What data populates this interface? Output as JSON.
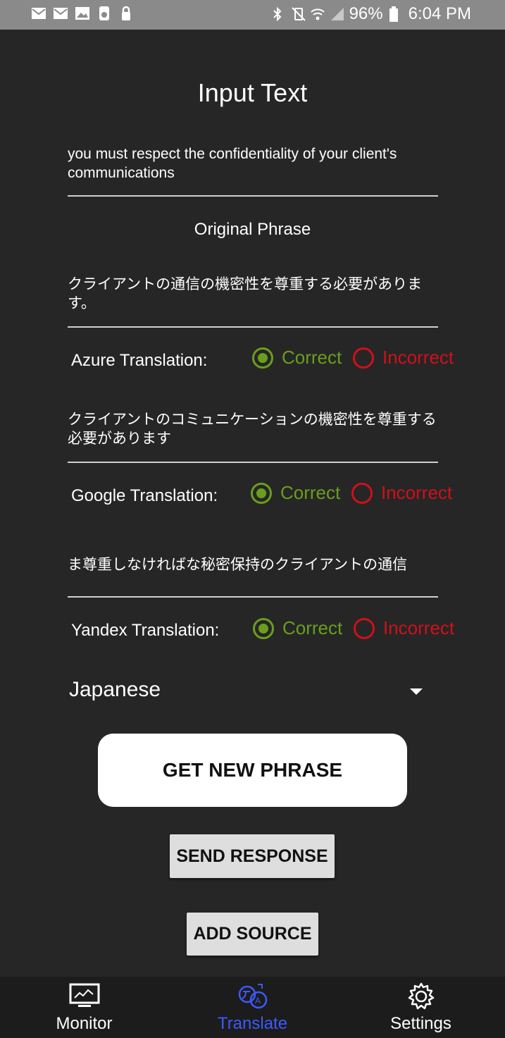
{
  "status_bar": {
    "battery": "96%",
    "time": "6:04 PM",
    "left_icons": [
      "mail-icon",
      "mail-icon",
      "image-icon",
      "lock-icon",
      "lock-icon"
    ],
    "right_icons": [
      "bluetooth-icon",
      "vibrate-mute-icon",
      "wifi-icon",
      "signal-icon",
      "battery-icon"
    ]
  },
  "page": {
    "title": "Input Text"
  },
  "input_text": {
    "value": "you must respect the confidentiality of your client's communications"
  },
  "original": {
    "label": "Original Phrase",
    "value": "クライアントの通信の機密性を尊重する必要があります。"
  },
  "azure": {
    "label": "Azure Translation:",
    "value": "クライアントのコミュニケーションの機密性を尊重する必要があります"
  },
  "google": {
    "label": "Google Translation:",
    "value": "ま尊重しなければな秘密保持のクライアントの通信"
  },
  "yandex": {
    "label": "Yandex Translation:"
  },
  "radio": {
    "correct": "Correct",
    "incorrect": "Incorrect"
  },
  "language": {
    "selected": "Japanese"
  },
  "buttons": {
    "get_new_phrase": "GET NEW PHRASE",
    "send_response": "SEND RESPONSE",
    "add_source": "ADD SOURCE"
  },
  "nav": {
    "items": [
      {
        "label": "Monitor",
        "icon": "monitor-icon",
        "active": false
      },
      {
        "label": "Translate",
        "icon": "translate-icon",
        "active": true
      },
      {
        "label": "Settings",
        "icon": "gear-icon",
        "active": false
      }
    ]
  },
  "colors": {
    "correct": "#6b9e1d",
    "incorrect": "#d0101a",
    "active_nav": "#3d5afe",
    "background": "#262626"
  }
}
